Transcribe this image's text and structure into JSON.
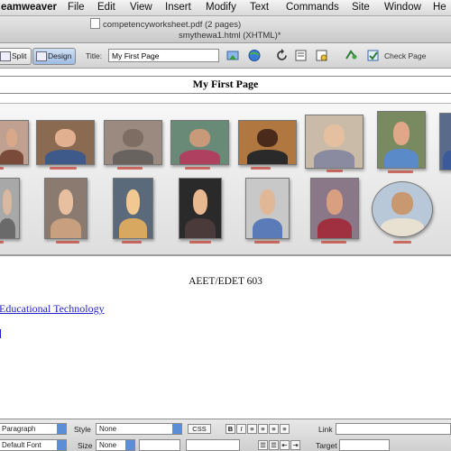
{
  "menubar": {
    "app": "eamweaver",
    "items": [
      "File",
      "Edit",
      "View",
      "Insert",
      "Modify",
      "Text",
      "Commands",
      "Site",
      "Window",
      "He"
    ]
  },
  "tabs": {
    "pdf_tab": "competencyworksheet.pdf (2 pages)",
    "html_tab": "smythewa1.html (XHTML)*"
  },
  "toolbar": {
    "split": "Split",
    "design": "Design",
    "title_label": "Title:",
    "title_value": "My First Page",
    "check_page": "Check Page"
  },
  "page": {
    "heading": "My First Page",
    "course_code": "AEET/EDET 603",
    "link_text": "Educational Technology"
  },
  "properties": {
    "format_value": "Paragraph",
    "style_label": "Style",
    "style_value": "None",
    "css_button": "CSS",
    "bold": "B",
    "italic": "I",
    "link_label": "Link",
    "font_value": "Default Font",
    "size_label": "Size",
    "size_value": "None",
    "target_label": "Target"
  },
  "colors": {
    "link": "#2222cc",
    "selected_view": "#9dbbe3"
  }
}
